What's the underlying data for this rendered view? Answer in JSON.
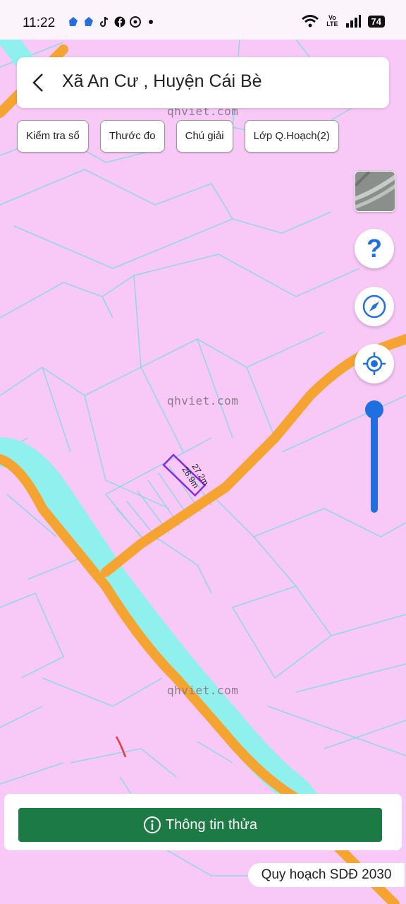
{
  "status_bar": {
    "time": "11:22",
    "volte": "Vo\nLTE",
    "battery": "74"
  },
  "header": {
    "title": "Xã An Cư , Huyện Cái Bè"
  },
  "toolbar": {
    "chips": [
      "Kiểm tra sổ",
      "Thước đo",
      "Chú giải",
      "Lớp Q.Hoạch(2)"
    ]
  },
  "map": {
    "watermark": "qhviet.com",
    "parcel_length_1": "27.2m",
    "parcel_length_2": "26.9m",
    "land_color": "#f8c8f7",
    "water_color": "#8ff0ee",
    "road_color": "#f6a431",
    "boundary_color": "#8fd8e6"
  },
  "zoom_slider": {
    "level": 0.92
  },
  "bottom": {
    "info_button": "Thông tin thửa",
    "plan_label": "Quy hoạch SDĐ 2030"
  }
}
